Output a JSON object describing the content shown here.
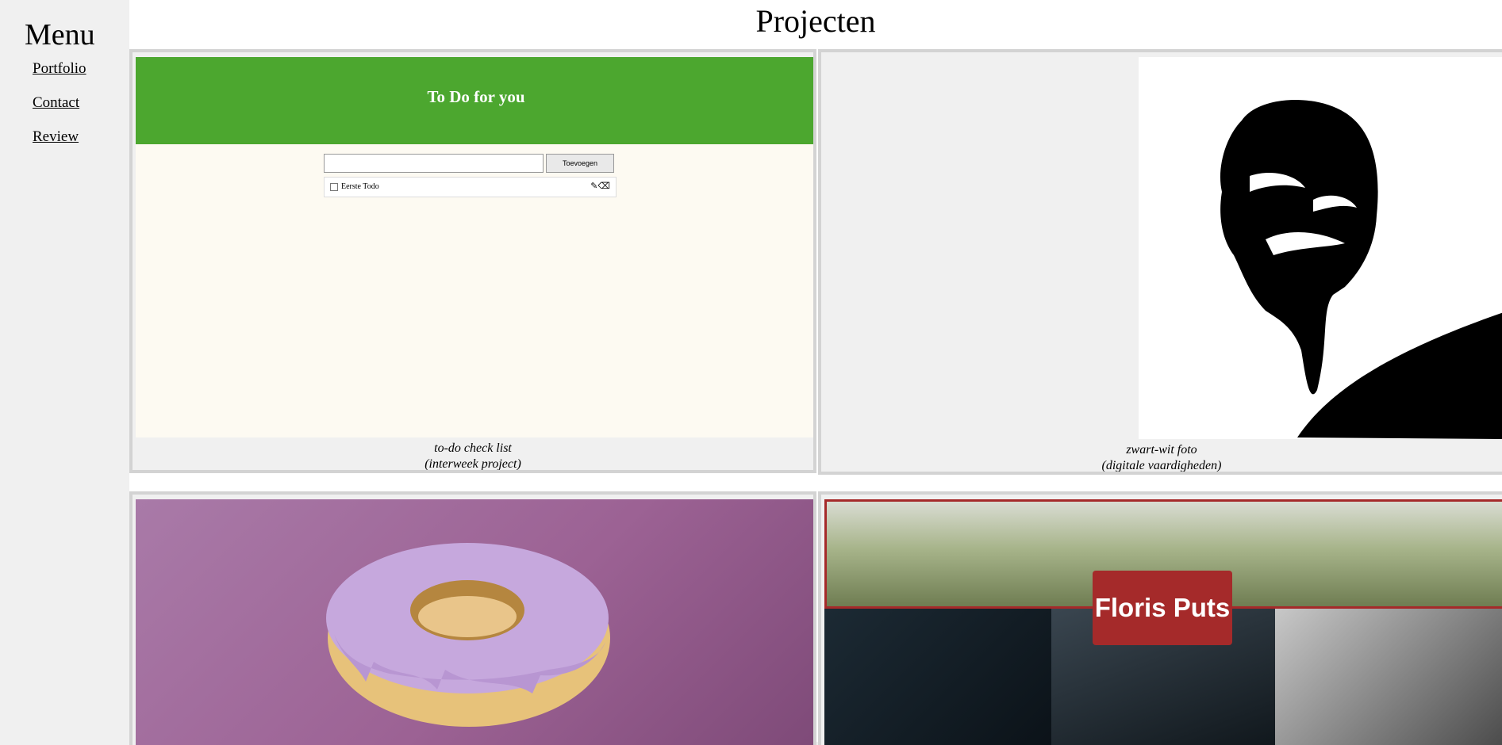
{
  "sidebar": {
    "title": "Menu",
    "links": [
      {
        "label": "Portfolio"
      },
      {
        "label": "Contact"
      },
      {
        "label": "Review"
      }
    ]
  },
  "main": {
    "title": "Projecten",
    "projects": [
      {
        "caption_line1": "to-do check list",
        "caption_line2": "(interweek project)",
        "preview": {
          "header": "To Do for you",
          "input_value": "",
          "add_button": "Toevoegen",
          "items": [
            {
              "label": "Eerste Todo",
              "checked": false
            }
          ]
        }
      },
      {
        "caption_line1": "zwart-wit foto",
        "caption_line2": "(digitale vaardigheden)"
      },
      {},
      {
        "preview": {
          "name": "Floris Puts"
        }
      }
    ]
  },
  "colors": {
    "todo_green": "#4ca72f",
    "badge_red": "#a52a2a",
    "donut_background": "#9c6294"
  }
}
